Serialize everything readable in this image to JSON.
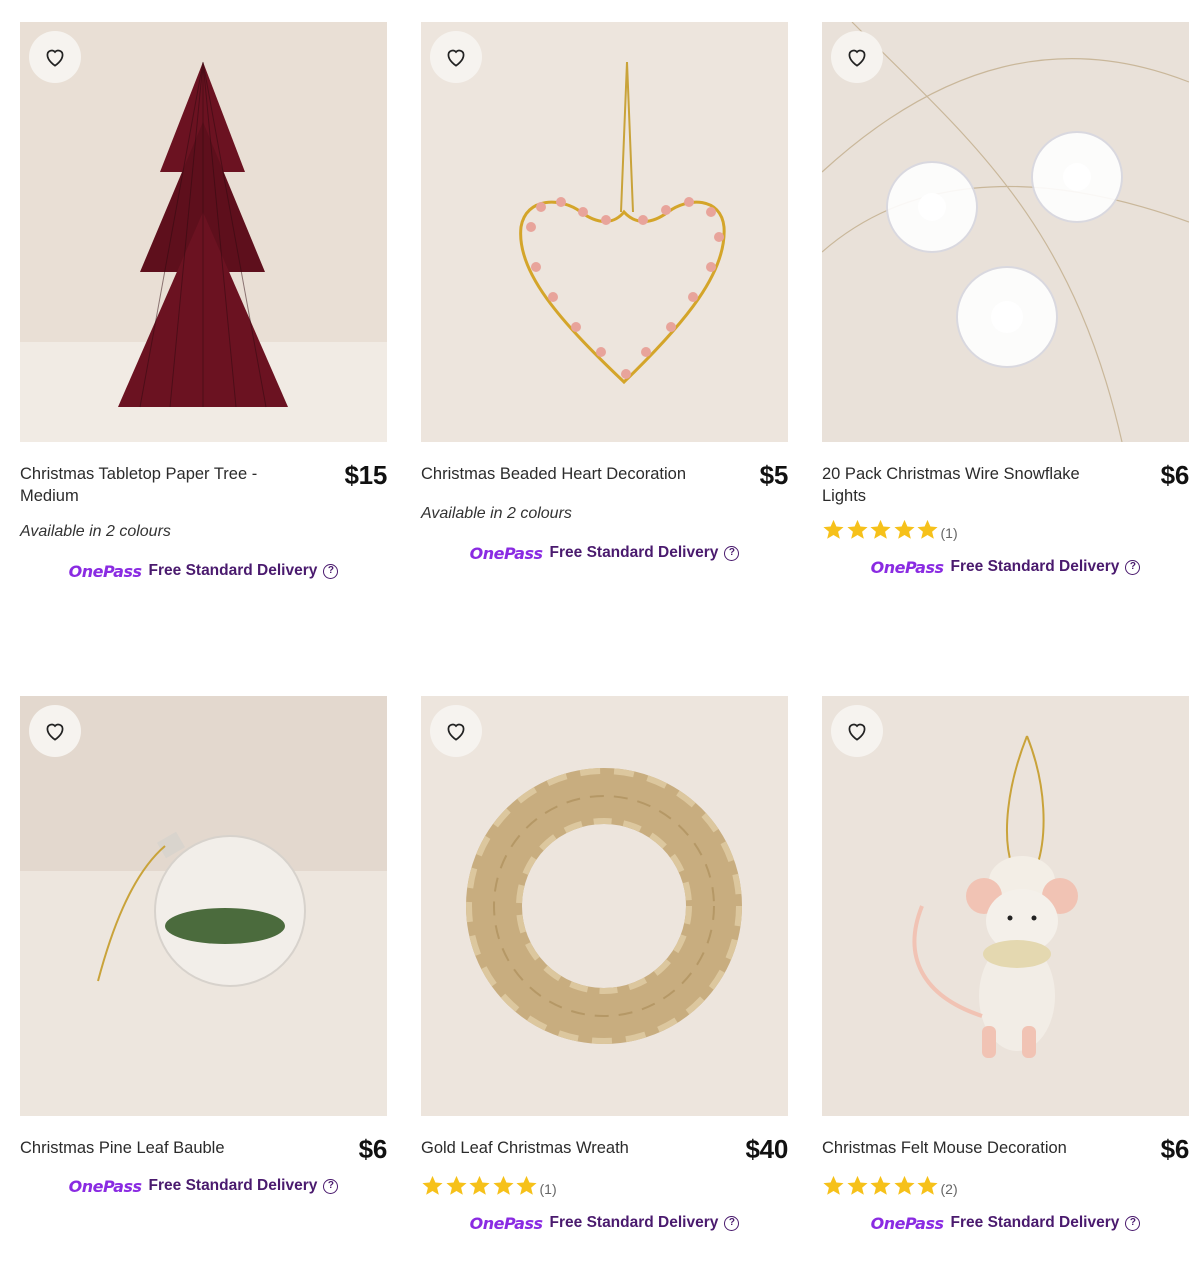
{
  "products": [
    {
      "name": "Christmas Tabletop Paper Tree - Medium",
      "price": "$15",
      "availability": "Available in 2 colours",
      "rating_count": null,
      "image": "red-paper-tree"
    },
    {
      "name": "Christmas Beaded Heart Decoration",
      "price": "$5",
      "availability": "Available in 2 colours",
      "rating_count": null,
      "image": "beaded-heart"
    },
    {
      "name": "20 Pack Christmas Wire Snowflake Lights",
      "price": "$6",
      "availability": null,
      "rating_count": "(1)",
      "image": "snowflake-lights"
    },
    {
      "name": "Christmas Pine Leaf Bauble",
      "price": "$6",
      "availability": null,
      "rating_count": null,
      "image": "pine-bauble"
    },
    {
      "name": "Gold Leaf Christmas Wreath",
      "price": "$40",
      "availability": null,
      "rating_count": "(1)",
      "image": "gold-wreath"
    },
    {
      "name": "Christmas Felt Mouse Decoration",
      "price": "$6",
      "availability": null,
      "rating_count": "(2)",
      "image": "felt-mouse"
    }
  ],
  "delivery": {
    "brand": "OnePass",
    "label": "Free Standard Delivery",
    "help": "?"
  },
  "rating_stars": 5,
  "colors": {
    "onepass_purple": "#8a2be2",
    "delivery_text": "#4a1a6e",
    "star": "#f6c11a",
    "image_bg": "#ece4dc"
  }
}
